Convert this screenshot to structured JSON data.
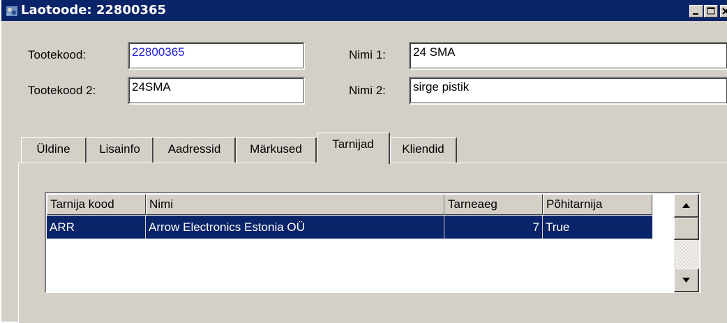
{
  "window": {
    "title": "Laotoode: 22800365"
  },
  "form": {
    "tootekood_label": "Tootekood:",
    "tootekood_value": "22800365",
    "tootekood2_label": "Tootekood 2:",
    "tootekood2_value": "24SMA",
    "nimi1_label": "Nimi 1:",
    "nimi1_value": "24 SMA",
    "nimi2_label": "Nimi 2:",
    "nimi2_value": "sirge pistik",
    "link_color": "#0000ff"
  },
  "tabs": [
    {
      "label": "Üldine",
      "active": false
    },
    {
      "label": "Lisainfo",
      "active": false
    },
    {
      "label": "Aadressid",
      "active": false
    },
    {
      "label": "Märkused",
      "active": false
    },
    {
      "label": "Tarnijad",
      "active": true
    },
    {
      "label": "Kliendid",
      "active": false
    }
  ],
  "grid": {
    "columns": [
      "Tarnija kood",
      "Nimi",
      "Tarneaeg",
      "Põhitarnija"
    ],
    "rows": [
      {
        "kood": "ARR",
        "nimi": "Arrow Electronics Estonia OÜ",
        "tarneaeg": "7",
        "pohitarnija": "True",
        "selected": true
      }
    ],
    "selection_color": "#0a246a"
  },
  "icons": {
    "app": "app-icon",
    "minimize": "minimize-icon",
    "maximize": "maximize-icon",
    "close": "close-icon",
    "scroll_up": "arrow-up-icon",
    "scroll_down": "arrow-down-icon"
  }
}
